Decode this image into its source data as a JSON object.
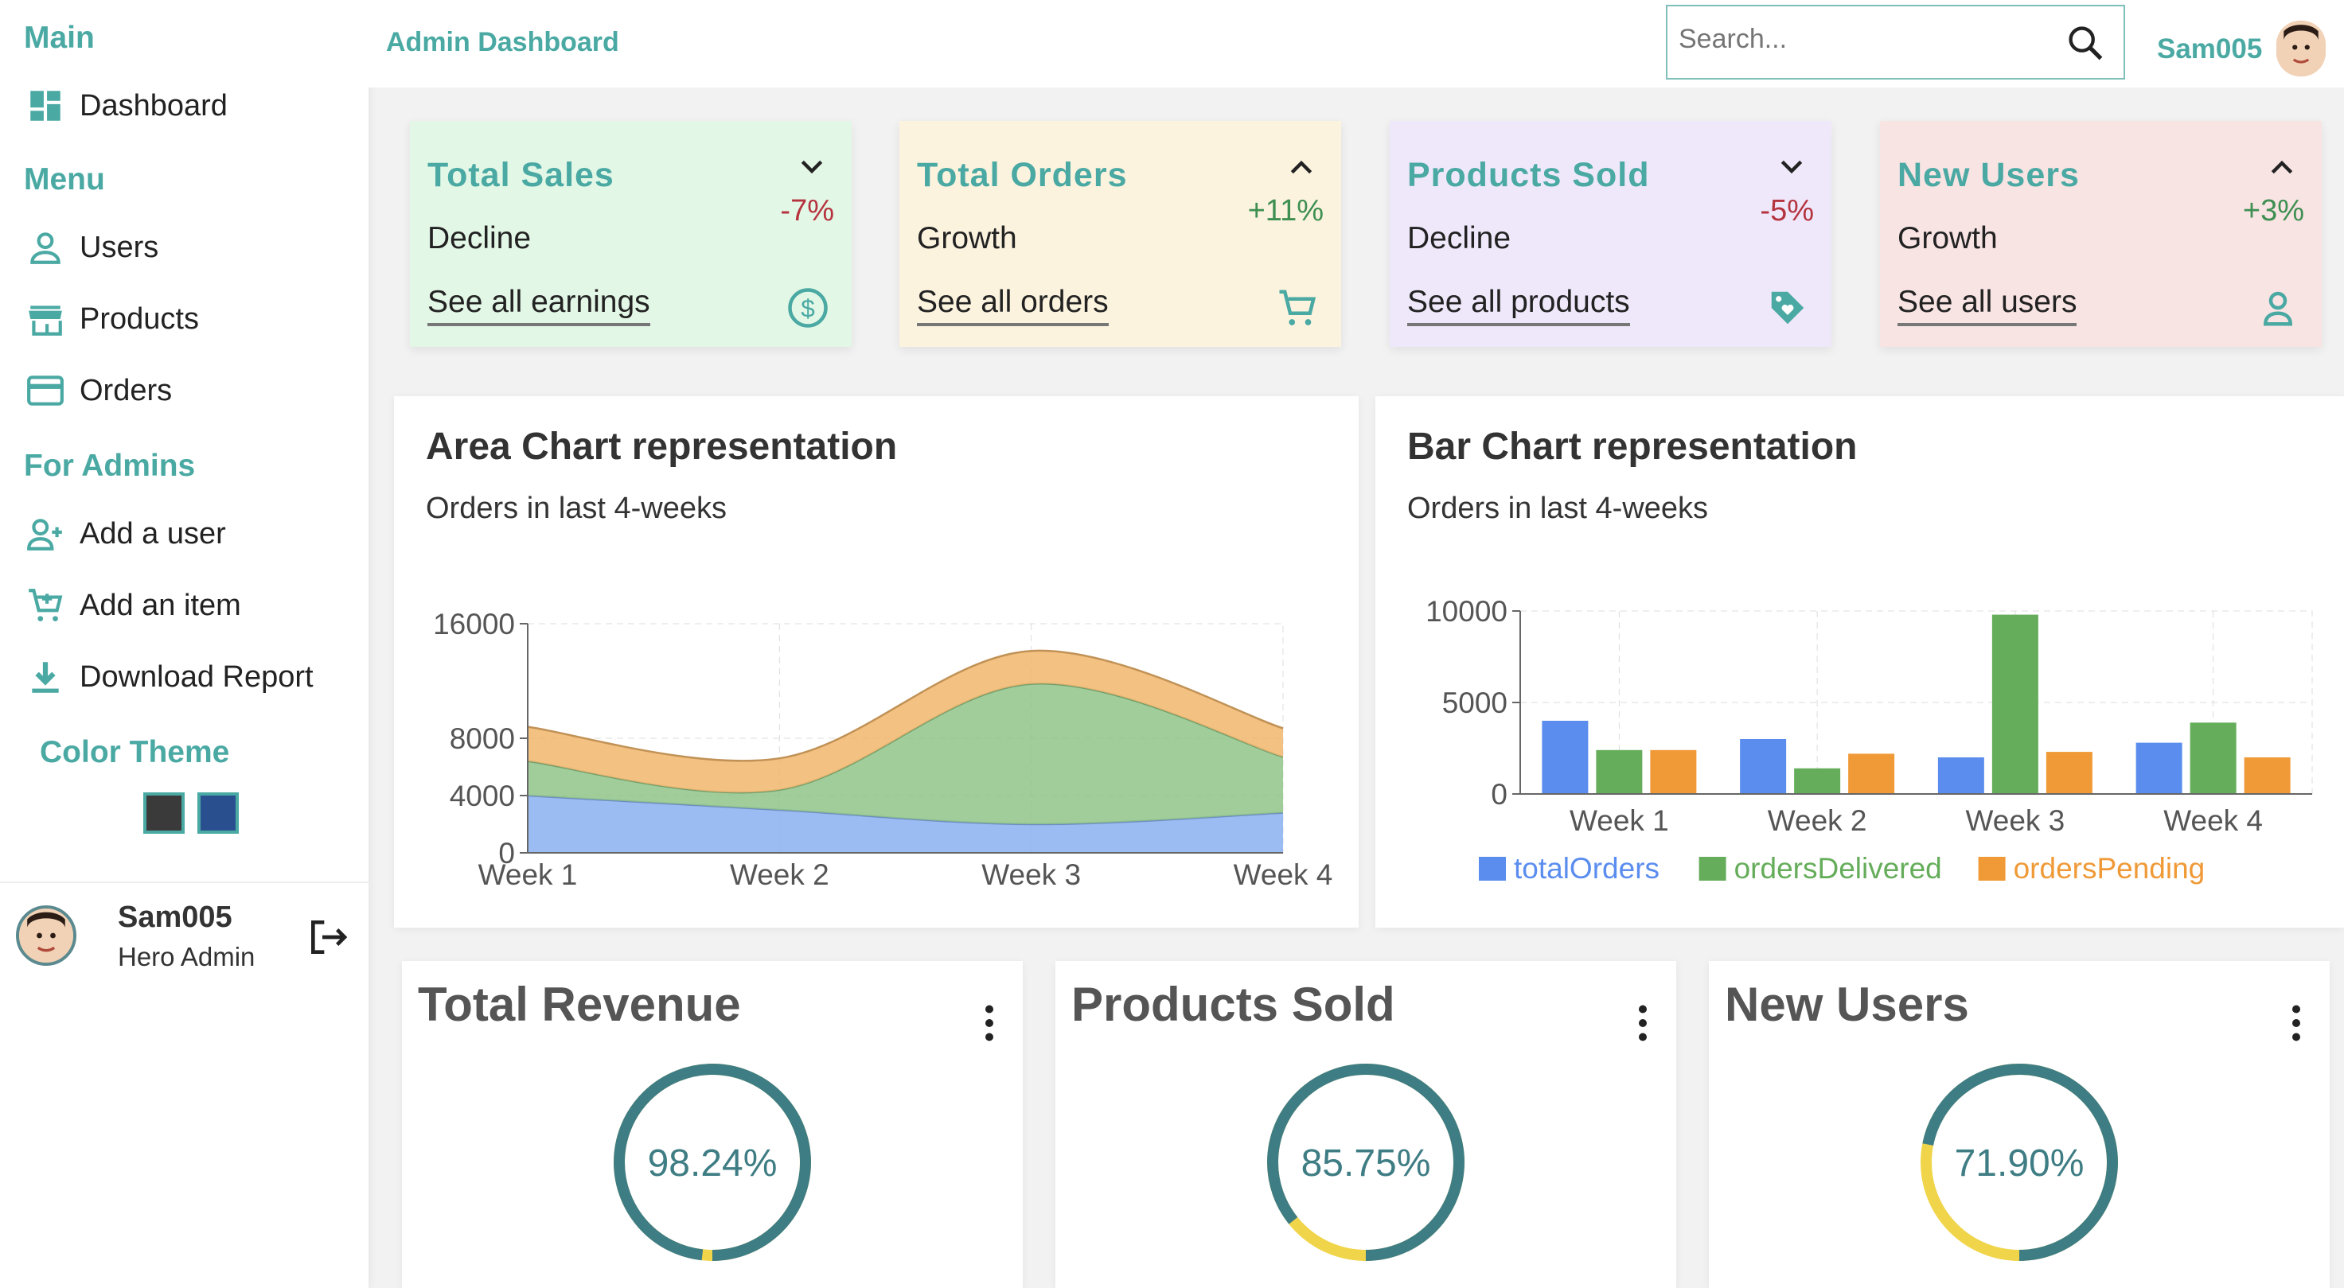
{
  "sidebar": {
    "sections": {
      "main": "Main",
      "menu": "Menu",
      "admins": "For Admins",
      "theme": "Color Theme"
    },
    "items": [
      {
        "label": "Dashboard",
        "icon": "dashboard-icon"
      },
      {
        "label": "Users",
        "icon": "user-icon"
      },
      {
        "label": "Products",
        "icon": "store-icon"
      },
      {
        "label": "Orders",
        "icon": "credit-card-icon"
      },
      {
        "label": "Add a user",
        "icon": "user-plus-icon"
      },
      {
        "label": "Add an item",
        "icon": "cart-plus-icon"
      },
      {
        "label": "Download Report",
        "icon": "download-icon"
      }
    ],
    "theme_colors": [
      "#3a3a3a",
      "#2a4f8f"
    ],
    "profile": {
      "name": "Sam005",
      "role": "Hero Admin"
    }
  },
  "header": {
    "title": "Admin Dashboard",
    "search_placeholder": "Search...",
    "username": "Sam005"
  },
  "kpis": [
    {
      "title": "Total Sales",
      "pct": "-7%",
      "trend": "down",
      "status": "Decline",
      "link": "See all earnings",
      "bg": "#e3f7e6",
      "icon": "dollar-icon"
    },
    {
      "title": "Total Orders",
      "pct": "+11%",
      "trend": "up",
      "status": "Growth",
      "link": "See all orders",
      "bg": "#fcf3df",
      "icon": "cart-icon"
    },
    {
      "title": "Products Sold",
      "pct": "-5%",
      "trend": "down",
      "status": "Decline",
      "link": "See all products",
      "bg": "#efe8fa",
      "icon": "tag-heart-icon"
    },
    {
      "title": "New Users",
      "pct": "+3%",
      "trend": "up",
      "status": "Growth",
      "link": "See all users",
      "bg": "#f9e4e4",
      "icon": "user-icon"
    }
  ],
  "colors": {
    "accent": "#4aa9a3",
    "negative": "#b5333f",
    "positive": "#3e8f52",
    "donut_ring": "#3f7d84",
    "donut_accent": "#f0d54a"
  },
  "area_panel": {
    "title": "Area Chart representation",
    "subtitle": "Orders in last 4-weeks"
  },
  "bar_panel": {
    "title": "Bar Chart representation",
    "subtitle": "Orders in last 4-weeks"
  },
  "chart_data": [
    {
      "type": "area",
      "stacked": true,
      "categories": [
        "Week 1",
        "Week 2",
        "Week 3",
        "Week 4"
      ],
      "yticks": [
        0,
        4000,
        8000,
        16000
      ],
      "ylim": [
        0,
        16000
      ],
      "grid": true,
      "series": [
        {
          "values": [
            4000,
            3000,
            2000,
            2800
          ],
          "color": "#8ab0f0"
        },
        {
          "values": [
            2400,
            1400,
            9800,
            3900
          ],
          "color": "#8fc487"
        },
        {
          "values": [
            2400,
            2200,
            2300,
            2000
          ],
          "color": "#f1b66c"
        }
      ]
    },
    {
      "type": "bar",
      "categories": [
        "Week 1",
        "Week 2",
        "Week 3",
        "Week 4"
      ],
      "yticks": [
        0,
        5000,
        10000
      ],
      "ylim": [
        0,
        10000
      ],
      "grid": true,
      "legend": "bottom",
      "series": [
        {
          "name": "totalOrders",
          "values": [
            4000,
            3000,
            2000,
            2800
          ],
          "color": "#5b8def"
        },
        {
          "name": "ordersDelivered",
          "values": [
            2400,
            1400,
            9800,
            3900
          ],
          "color": "#65ad5a"
        },
        {
          "name": "ordersPending",
          "values": [
            2400,
            2200,
            2300,
            2000
          ],
          "color": "#ef9a37"
        }
      ]
    },
    {
      "type": "pie",
      "title": "Total Revenue",
      "value_label": "98.24%",
      "value": 98.24
    },
    {
      "type": "pie",
      "title": "Products Sold",
      "value_label": "85.75%",
      "value": 85.75
    },
    {
      "type": "pie",
      "title": "New Users",
      "value_label": "71.90%",
      "value": 71.9
    }
  ]
}
